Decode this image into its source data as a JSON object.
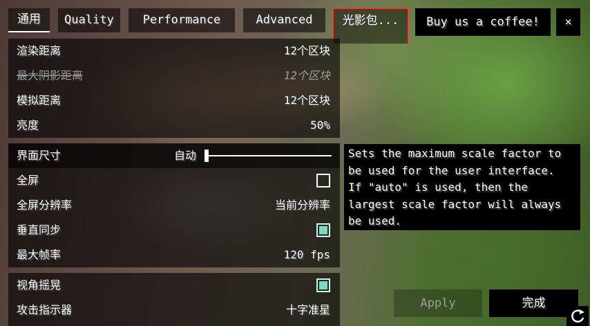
{
  "tabs": [
    {
      "label": "通用",
      "active": true
    },
    {
      "label": "Quality",
      "active": false
    },
    {
      "label": "Performance",
      "active": false
    },
    {
      "label": "Advanced",
      "active": false
    },
    {
      "label": "光影包...",
      "active": false
    }
  ],
  "header": {
    "coffee_label": "Buy us a coffee!",
    "close_label": "×"
  },
  "group1": [
    {
      "label": "渲染距离",
      "value": "12个区块"
    },
    {
      "label": "最大阴影距离",
      "value": "12个区块",
      "disabled": true
    },
    {
      "label": "模拟距离",
      "value": "12个区块"
    },
    {
      "label": "亮度",
      "value": "50%"
    }
  ],
  "group2": {
    "gui_scale": {
      "label": "界面尺寸",
      "value": "自动",
      "level": 0
    },
    "fullscreen": {
      "label": "全屏",
      "checked": false
    },
    "fullscreen_resolution": {
      "label": "全屏分辨率",
      "value": "当前分辨率"
    },
    "vsync": {
      "label": "垂直同步",
      "checked": true
    },
    "max_fps": {
      "label": "最大帧率",
      "value": "120 fps"
    }
  },
  "group3": {
    "view_bobbing": {
      "label": "视角摇晃",
      "checked": true
    },
    "attack_indicator": {
      "label": "攻击指示器",
      "value": "十字准星"
    }
  },
  "tooltip": {
    "lines": [
      "Sets the maximum scale factor to",
      "be used for the user interface.",
      "If \"auto\" is used, then the",
      "largest scale factor will always",
      "be used."
    ]
  },
  "footer": {
    "apply_label": "Apply",
    "done_label": "完成"
  },
  "colors": {
    "checkbox_on": "#7ed9bd",
    "highlight_border": "#ff2e2e"
  },
  "icons": {
    "reset": "refresh-icon"
  }
}
